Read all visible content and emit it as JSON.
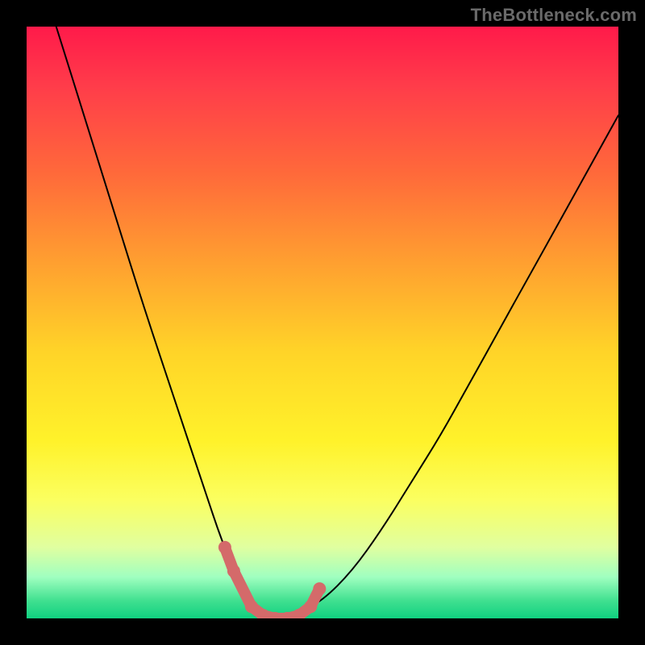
{
  "watermark": "TheBottleneck.com",
  "chart_data": {
    "type": "line",
    "title": "",
    "xlabel": "",
    "ylabel": "",
    "xlim": [
      0,
      100
    ],
    "ylim": [
      0,
      100
    ],
    "grid": false,
    "series": [
      {
        "name": "curve",
        "color": "#000000",
        "x": [
          5,
          10,
          15,
          20,
          25,
          30,
          33,
          36,
          38,
          40,
          42,
          44,
          46,
          50,
          55,
          60,
          65,
          70,
          75,
          80,
          85,
          90,
          95,
          100
        ],
        "y": [
          100,
          84,
          68,
          52,
          37,
          22,
          13,
          6,
          3,
          1,
          0,
          0,
          1,
          3,
          8,
          15,
          23,
          31,
          40,
          49,
          58,
          67,
          76,
          85
        ]
      },
      {
        "name": "valley-markers",
        "color": "#d46a6a",
        "marker_x": [
          33.5,
          35,
          38,
          40,
          42,
          44,
          46,
          48,
          49.5
        ],
        "marker_y": [
          12,
          8,
          2,
          0.5,
          0,
          0,
          0.5,
          2,
          5
        ]
      }
    ]
  }
}
